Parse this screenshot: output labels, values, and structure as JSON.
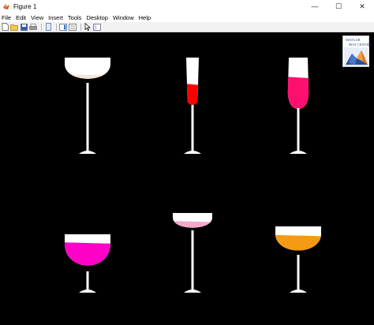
{
  "window": {
    "title": "Figure 1",
    "controls": {
      "minimize": "—",
      "maximize": "☐",
      "close": "✕"
    }
  },
  "menubar": {
    "items": [
      {
        "label": "File",
        "name": "menu-file"
      },
      {
        "label": "Edit",
        "name": "menu-edit"
      },
      {
        "label": "View",
        "name": "menu-view"
      },
      {
        "label": "Insert",
        "name": "menu-insert"
      },
      {
        "label": "Tools",
        "name": "menu-tools"
      },
      {
        "label": "Desktop",
        "name": "menu-desktop"
      },
      {
        "label": "Window",
        "name": "menu-window"
      },
      {
        "label": "Help",
        "name": "menu-help"
      }
    ]
  },
  "toolbar": {
    "buttons": [
      {
        "icon": "new-figure-icon"
      },
      {
        "icon": "open-file-icon"
      },
      {
        "icon": "save-icon"
      },
      {
        "icon": "print-icon"
      },
      {
        "separator": true
      },
      {
        "icon": "link-plot-icon"
      },
      {
        "separator": true
      },
      {
        "icon": "colorbar-icon"
      },
      {
        "icon": "legend-icon"
      },
      {
        "separator": true
      },
      {
        "icon": "pointer-icon"
      },
      {
        "icon": "property-inspector-icon"
      }
    ]
  },
  "logo": {
    "line1": "MATLAB",
    "line2": "BOX CENTER"
  },
  "figure": {
    "background": "#000000",
    "glass_stroke": "#ffffff",
    "glasses": [
      {
        "name": "glass-1",
        "shape": "coupe",
        "liquid_color": "#f2e6d8",
        "fill_level": 0.35
      },
      {
        "name": "glass-2",
        "shape": "flute",
        "liquid_color": "#ff0000",
        "fill_level": 0.45
      },
      {
        "name": "glass-3",
        "shape": "tulip",
        "liquid_color": "#ff0f6e",
        "fill_level": 0.62
      },
      {
        "name": "glass-4",
        "shape": "bowl",
        "liquid_color": "#ff00c8",
        "fill_level": 0.78
      },
      {
        "name": "glass-5",
        "shape": "coupe",
        "liquid_color": "#f5a8c8",
        "fill_level": 0.55
      },
      {
        "name": "glass-6",
        "shape": "bowl",
        "liquid_color": "#f59a14",
        "fill_level": 0.7
      }
    ]
  }
}
